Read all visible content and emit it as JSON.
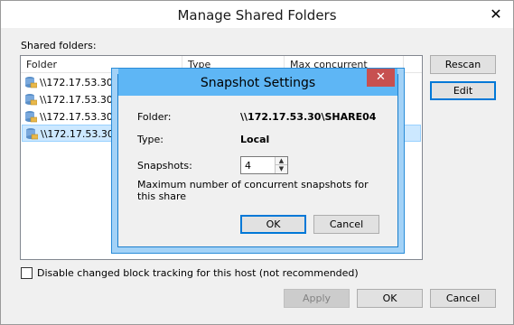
{
  "window": {
    "title": "Manage Shared Folders",
    "close_glyph": "✕"
  },
  "shared_folders": {
    "label": "Shared folders:",
    "columns": [
      "Folder",
      "Type",
      "Max concurrent snaps..."
    ],
    "rows": [
      {
        "folder": "\\\\172.17.53.30\\S",
        "selected": false
      },
      {
        "folder": "\\\\172.17.53.30\\S",
        "selected": false
      },
      {
        "folder": "\\\\172.17.53.30\\S",
        "selected": false
      },
      {
        "folder": "\\\\172.17.53.30\\S",
        "selected": true
      }
    ]
  },
  "side_buttons": {
    "rescan": "Rescan",
    "edit": "Edit"
  },
  "cbt": {
    "checked": false,
    "label": "Disable changed block tracking for this host (not recommended)"
  },
  "footer": {
    "apply": "Apply",
    "ok": "OK",
    "cancel": "Cancel"
  },
  "dialog": {
    "title": "Snapshot Settings",
    "close_glyph": "✕",
    "folder_label": "Folder:",
    "folder_value": "\\\\172.17.53.30\\SHARE04",
    "type_label": "Type:",
    "type_value": "Local",
    "snapshots_label": "Snapshots:",
    "snapshots_value": "4",
    "description": "Maximum number of concurrent snapshots for this share",
    "ok": "OK",
    "cancel": "Cancel"
  },
  "colors": {
    "dialog_title_bg": "#5eb6f5",
    "close_red": "#c75050",
    "selection": "#cce8ff",
    "focus_blue": "#0078d7"
  }
}
